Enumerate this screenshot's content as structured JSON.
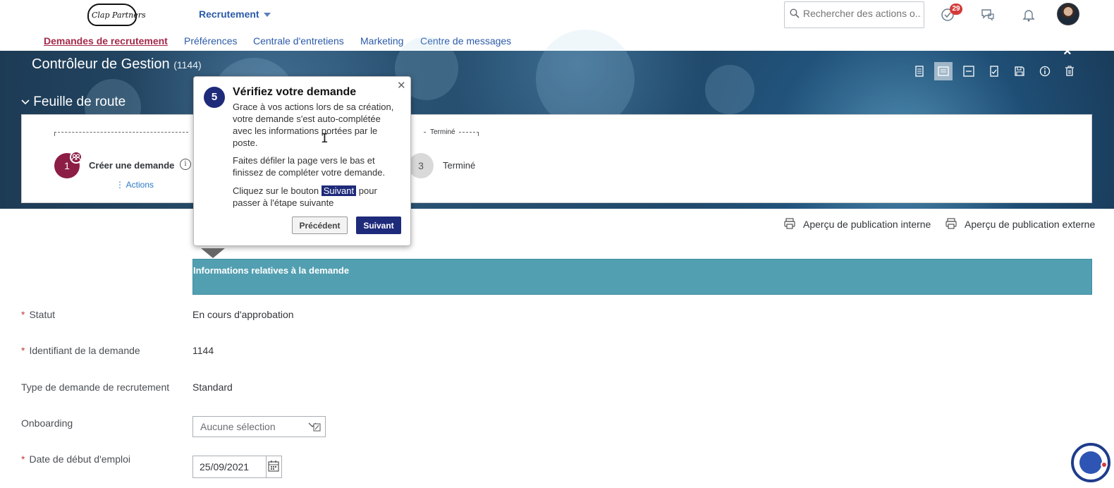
{
  "shell": {
    "logo_text": "Clap Partners",
    "module": "Recrutement",
    "search_placeholder": "Rechercher des actions o...",
    "notification_count": "29",
    "icons": [
      "search-icon",
      "approvals-icon",
      "chat-icon",
      "bell-icon",
      "avatar"
    ]
  },
  "nav": {
    "items": [
      {
        "label": "Demandes de recrutement",
        "active": true
      },
      {
        "label": "Préférences",
        "active": false
      },
      {
        "label": "Centrale d'entretiens",
        "active": false
      },
      {
        "label": "Marketing",
        "active": false
      },
      {
        "label": "Centre de messages",
        "active": false
      }
    ]
  },
  "header": {
    "title": "Contrôleur de Gestion",
    "id": "(1144)",
    "close": "×",
    "toolbar_icons": [
      "form-icon",
      "list-icon",
      "collapse-icon",
      "checklist-icon",
      "save-icon",
      "info-icon",
      "delete-icon"
    ]
  },
  "roadmap": {
    "title": "Feuille de route",
    "top_label_end": "Terminé",
    "step1": {
      "number": "1",
      "name": "Créer une demande",
      "actions_label": "Actions"
    },
    "step3": {
      "number": "3",
      "name": "Terminé"
    }
  },
  "popover": {
    "step_number": "5",
    "title": "Vérifiez votre demande",
    "para1": "Grace à vos actions lors de sa création, votre demande s'est auto-complétée avec les informations portées par le poste.",
    "para2": "Faites défiler la page vers le bas et finissez de compléter votre demande.",
    "para3_pre": "Cliquez sur le bouton",
    "para3_highlight": "Suivant",
    "para3_post": "pour passer à l'étape suivante",
    "prev_button": "Précédent",
    "next_button": "Suivant"
  },
  "publication": {
    "internal": "Aperçu de publication interne",
    "external": "Aperçu de publication externe"
  },
  "section": {
    "title": "Informations relatives à la demande"
  },
  "fields": {
    "statut": {
      "label": "Statut",
      "value": "En cours d'approbation",
      "required": true
    },
    "identifiant": {
      "label": "Identifiant de la demande",
      "value": "1144",
      "required": true
    },
    "type": {
      "label": "Type de demande de recrutement",
      "value": "Standard",
      "required": false
    },
    "onboarding": {
      "label": "Onboarding",
      "value": "Aucune sélection",
      "required": false
    },
    "date_debut": {
      "label": "Date de début d'emploi",
      "value": "25/09/2021",
      "required": true
    }
  },
  "colors": {
    "brand_nav": "#2b5ba8",
    "active_nav": "#a52a4a",
    "step_active": "#8c1d44",
    "popover_accent": "#1e2a7a",
    "section_bar": "#529fb1",
    "badge": "#d43b3b"
  }
}
